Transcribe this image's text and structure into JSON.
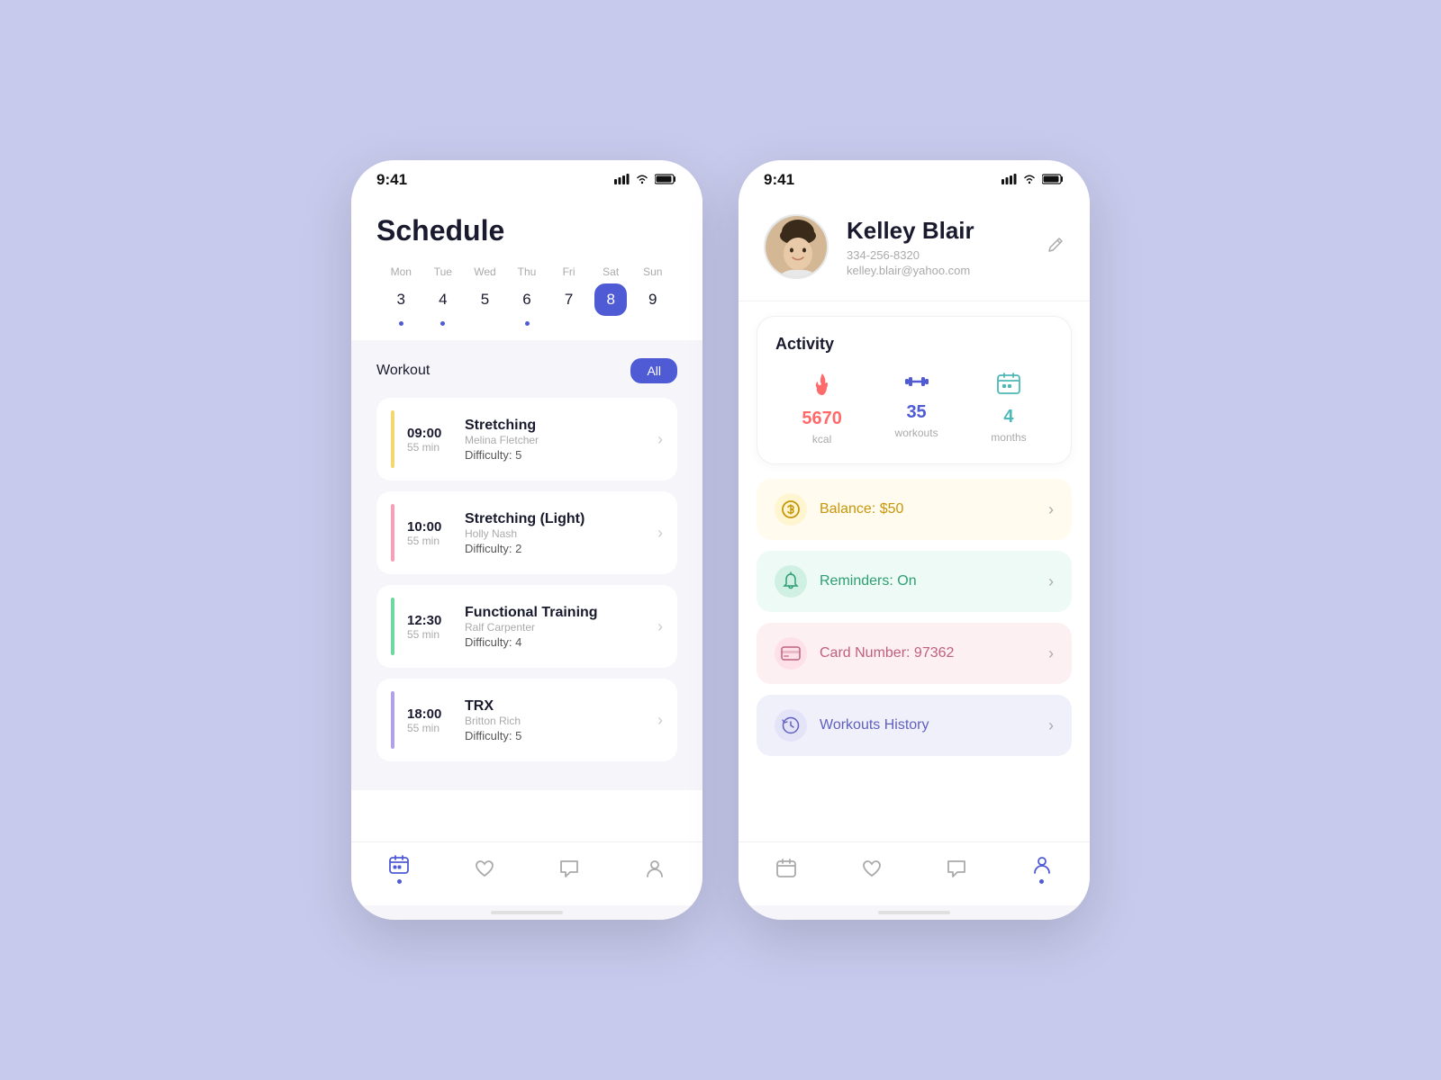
{
  "bg_color": "#c8caed",
  "phone1": {
    "status_time": "9:41",
    "title": "Schedule",
    "calendar": {
      "days": [
        {
          "label": "Mon",
          "num": "3",
          "dot": true,
          "active": false
        },
        {
          "label": "Tue",
          "num": "4",
          "dot": true,
          "active": false
        },
        {
          "label": "Wed",
          "num": "5",
          "dot": false,
          "active": false
        },
        {
          "label": "Thu",
          "num": "6",
          "dot": true,
          "active": false
        },
        {
          "label": "Fri",
          "num": "7",
          "dot": false,
          "active": false
        },
        {
          "label": "Sat",
          "num": "8",
          "dot": false,
          "active": true
        },
        {
          "label": "Sun",
          "num": "9",
          "dot": false,
          "active": false
        }
      ]
    },
    "workout_label": "Workout",
    "all_btn": "All",
    "workouts": [
      {
        "time": "09:00",
        "duration": "55 min",
        "name": "Stretching",
        "trainer": "Melina Fletcher",
        "difficulty": "Difficulty: 5",
        "color": "#f5d76e"
      },
      {
        "time": "10:00",
        "duration": "55 min",
        "name": "Stretching (Light)",
        "trainer": "Holly Nash",
        "difficulty": "Difficulty: 2",
        "color": "#f5a0b4"
      },
      {
        "time": "12:30",
        "duration": "55 min",
        "name": "Functional Training",
        "trainer": "Ralf Carpenter",
        "difficulty": "Difficulty: 4",
        "color": "#6ed8a0"
      },
      {
        "time": "18:00",
        "duration": "55 min",
        "name": "TRX",
        "trainer": "Britton Rich",
        "difficulty": "Difficulty: 5",
        "color": "#b4a0e8"
      }
    ],
    "nav": {
      "calendar_active": true,
      "items": [
        "calendar",
        "heart",
        "chat",
        "person"
      ]
    }
  },
  "phone2": {
    "status_time": "9:41",
    "user": {
      "name": "Kelley Blair",
      "phone": "334-256-8320",
      "email": "kelley.blair@yahoo.com"
    },
    "activity": {
      "title": "Activity",
      "stats": [
        {
          "icon": "🔥",
          "value": "5670",
          "label": "kcal",
          "color_class": "stat-red"
        },
        {
          "icon": "🏋",
          "value": "35",
          "label": "workouts",
          "color_class": "stat-blue"
        },
        {
          "icon": "📅",
          "value": "4",
          "label": "months",
          "color_class": "stat-teal"
        }
      ]
    },
    "menu_items": [
      {
        "icon": "$",
        "text": "Balance: $50",
        "bg_class": "menu-yellow",
        "icon_unicode": "💲"
      },
      {
        "icon": "bell",
        "text": "Reminders: On",
        "bg_class": "menu-green",
        "icon_unicode": "🔔"
      },
      {
        "icon": "card",
        "text": "Card Number: 97362",
        "bg_class": "menu-pink",
        "icon_unicode": "💳"
      },
      {
        "icon": "history",
        "text": "Workouts History",
        "bg_class": "menu-lavender",
        "icon_unicode": "🕐"
      }
    ]
  }
}
